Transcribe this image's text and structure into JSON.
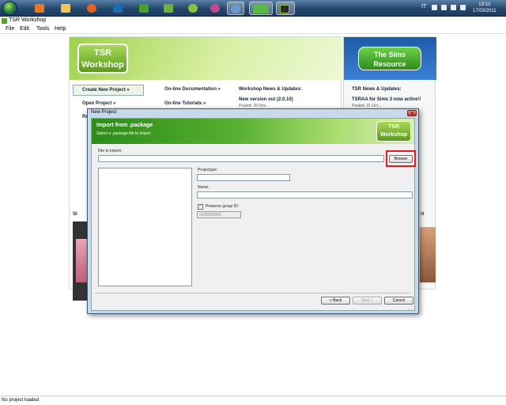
{
  "taskbar": {
    "icons": [
      {
        "name": "media-center-icon",
        "color": "#1e6fc0"
      },
      {
        "name": "media-player-icon",
        "color": "#e87a1c"
      },
      {
        "name": "file-explorer-icon",
        "color": "#f0c552"
      },
      {
        "name": "firefox-icon",
        "color": "#e8621c"
      },
      {
        "name": "photoshop-icon",
        "color": "#1c6ab0"
      },
      {
        "name": "app-green-icon",
        "color": "#4aa02c"
      },
      {
        "name": "app-shield-icon",
        "color": "#6ab43a"
      },
      {
        "name": "app-android-icon",
        "color": "#8ac33a"
      },
      {
        "name": "app-globe-icon",
        "color": "#c04a8a"
      },
      {
        "name": "browser-icon",
        "color": "#6a9ad4"
      },
      {
        "name": "sims-icon",
        "color": "#58b848"
      },
      {
        "name": "workshop-icon",
        "color": "#2a2a2a"
      }
    ],
    "lang": "IT",
    "time": "13:12",
    "date": "17/03/2011"
  },
  "app": {
    "title": "TSR Workshop",
    "menu": [
      "File",
      "Edit",
      "Tools",
      "Help"
    ],
    "status": "No project loaded"
  },
  "background": {
    "logo": "TSR Workshop",
    "create_new_project": "Create New Project »",
    "open_project": "Open Project »",
    "recent": "Re",
    "online_docs": "On-line Documentation »",
    "online_tutorials": "On-line Tutorials »",
    "news_title": "Workshop News & Updates:",
    "news_item": "New  version out (2.0.10)",
    "news_posted": "Posted: 25 Nov...",
    "right_logo": "The Sims Resource",
    "tsr_news_title": "TSR News & Updates:",
    "tsr_news_item": "TSRAA for Sims 3 now active!!",
    "tsr_news_posted": "Posted: 21 Oct...",
    "right_snip1": "rt",
    "right_snip2": "you",
    "left_snip": "Sl"
  },
  "dialog": {
    "title": "New Project",
    "close": "x",
    "header_title": "Import from .package",
    "header_subtitle": "Select a .package file to import",
    "logo": "TSR Workshop",
    "file_label": "File to import:",
    "file_value": "",
    "browse": "Browse",
    "projecttype_label": "Projectype:",
    "projecttype_value": "",
    "name_label": "Name:",
    "name_value": "",
    "preserve_label": "Preserve group ID:",
    "preserve_checked": "✓",
    "group_id": "0x00000000",
    "back": "< Back",
    "next": "Next >",
    "cancel": "Cancel"
  }
}
